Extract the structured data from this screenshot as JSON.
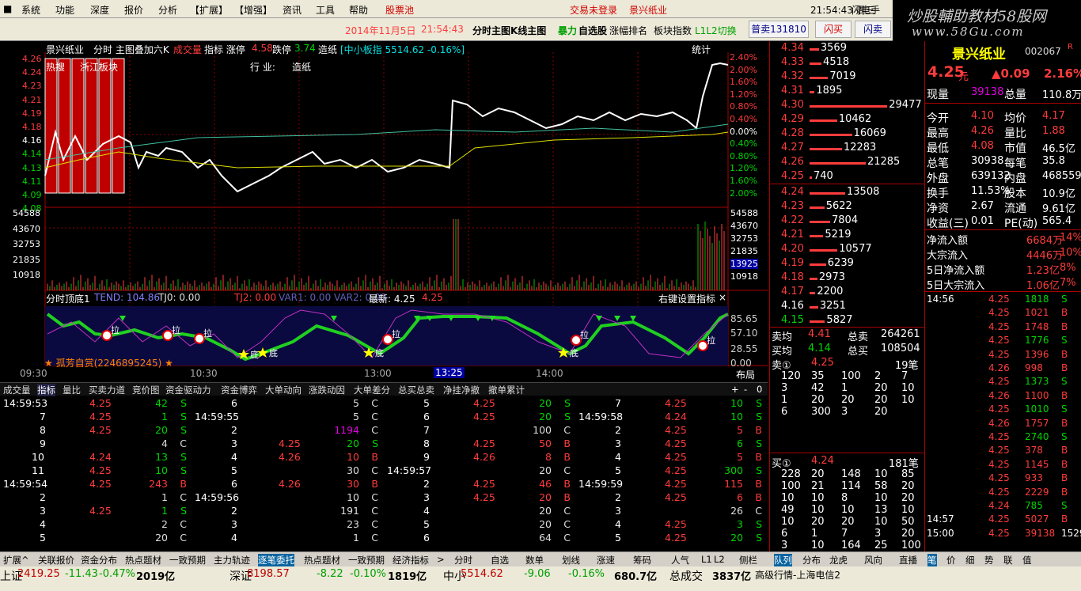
{
  "menu": {
    "items": [
      "系统",
      "功能",
      "深度",
      "报价",
      "分析",
      "【扩展】",
      "【增强】",
      "资讯",
      "工具",
      "帮助"
    ],
    "stock_pool": "股票池",
    "login_status": "交易未登录",
    "stock_title": "景兴纸业",
    "clock": "21:54:43 周三",
    "flash": "闪电手"
  },
  "header": {
    "date": "2014年11月5日",
    "time": "21:54:43",
    "chart_mode": "分时主图K线主图",
    "bull": "暴力",
    "watchlist": "自选股",
    "rank": "涨幅排名",
    "board": "板块指数",
    "level": "L1L2切换",
    "sell": "普卖131810",
    "flash_buy": "闪买",
    "flash_sell": "闪卖"
  },
  "brand": {
    "line1": "炒股輔助教材58股网",
    "line2": "www.58Gu.com"
  },
  "chart": {
    "title_name": "景兴纸业",
    "title_mode": "分时 主图叠加六K",
    "title_vol": "成交量",
    "title_rest": "指标 涨停",
    "limit_up": "4.58",
    "limit_down_label": "跌停",
    "limit_down": "3.74",
    "sector": "造纸",
    "index_label": "[中小板指 5514.62 -0.16%]",
    "stats": "统计",
    "hot_label": "热搜",
    "board_label": "浙江板块",
    "industry_label": "行  业:",
    "industry": "造纸",
    "prices": [
      "4.26",
      "4.24",
      "4.23",
      "4.21",
      "4.19",
      "4.18",
      "4.16",
      "4.14",
      "4.13",
      "4.11",
      "4.09",
      "4.08"
    ],
    "pcts": [
      "2.40%",
      "2.00%",
      "1.60%",
      "1.20%",
      "0.80%",
      "0.40%",
      "0.00%",
      "0.40%",
      "0.80%",
      "1.20%",
      "1.60%",
      "2.00%"
    ],
    "vols": [
      "54588",
      "43670",
      "32753",
      "21835",
      "10918"
    ],
    "vol_right": [
      "54588",
      "43670",
      "32753",
      "21835",
      "13925",
      "10918"
    ],
    "ind_title": "分时顶底1",
    "ind_tend": "TEND: 104.86",
    "ind_tj0": "TJ0: 0.00",
    "ind_tj2": "TJ2: 0.00",
    "ind_rest": "VAR1: 0.00  VAR2: 0.00",
    "ind_latest": "最新: 4.25",
    "ind_price": "4.25",
    "ind_setting": "右键设置指标",
    "ind_scale": [
      "85.65",
      "57.10",
      "28.55",
      "0.00"
    ],
    "promo": "孤芳自赏(2246895245)",
    "signal_la": "拉",
    "signal_di": "底",
    "times": [
      "09:30",
      "10:30",
      "13:00",
      "13:25",
      "14:00"
    ],
    "layout": "布局"
  },
  "tabs": [
    "成交量",
    "指标",
    "量比",
    "买卖力道",
    "竞价图",
    "资金驱动力",
    "资金博弈",
    "大单动向",
    "涨跌动因",
    "大单差分",
    "总买总卖",
    "净挂净撤",
    "撤单累计"
  ],
  "ticks": [
    [
      [
        "14:59:53",
        "4.25",
        "42",
        "S"
      ],
      [
        "7",
        "4.25",
        "1",
        "S"
      ],
      [
        "8",
        "4.25",
        "20",
        "S"
      ],
      [
        "9",
        "",
        "4",
        "C"
      ],
      [
        "10",
        "4.24",
        "13",
        "S"
      ],
      [
        "11",
        "4.25",
        "10",
        "S"
      ],
      [
        "14:59:54",
        "4.25",
        "243",
        "B"
      ],
      [
        "2",
        "",
        "1",
        "C"
      ],
      [
        "3",
        "4.25",
        "1",
        "S"
      ],
      [
        "4",
        "",
        "2",
        "C"
      ],
      [
        "5",
        "",
        "20",
        "C"
      ]
    ],
    [
      [
        "6",
        "",
        "5",
        "C"
      ],
      [
        "14:59:55",
        "",
        "5",
        "C"
      ],
      [
        "2",
        "",
        "1194",
        "C"
      ],
      [
        "3",
        "4.25",
        "20",
        "S"
      ],
      [
        "4",
        "4.26",
        "10",
        "B"
      ],
      [
        "5",
        "",
        "30",
        "C"
      ],
      [
        "6",
        "4.26",
        "30",
        "B"
      ],
      [
        "14:59:56",
        "",
        "10",
        "C"
      ],
      [
        "2",
        "",
        "191",
        "C"
      ],
      [
        "3",
        "",
        "23",
        "C"
      ],
      [
        "4",
        "",
        "1",
        "C"
      ]
    ],
    [
      [
        "5",
        "4.25",
        "20",
        "S"
      ],
      [
        "6",
        "4.25",
        "20",
        "S"
      ],
      [
        "7",
        "",
        "100",
        "C"
      ],
      [
        "8",
        "4.25",
        "50",
        "B"
      ],
      [
        "9",
        "4.26",
        "8",
        "B"
      ],
      [
        "14:59:57",
        "",
        "20",
        "C"
      ],
      [
        "2",
        "4.25",
        "46",
        "B"
      ],
      [
        "3",
        "4.25",
        "20",
        "B"
      ],
      [
        "4",
        "",
        "20",
        "C"
      ],
      [
        "5",
        "",
        "20",
        "C"
      ],
      [
        "6",
        "",
        "64",
        "C"
      ]
    ],
    [
      [
        "7",
        "4.25",
        "10",
        "S"
      ],
      [
        "14:59:58",
        "4.24",
        "10",
        "S"
      ],
      [
        "2",
        "4.25",
        "5",
        "B"
      ],
      [
        "3",
        "4.25",
        "6",
        "S"
      ],
      [
        "4",
        "4.25",
        "5",
        "B"
      ],
      [
        "5",
        "4.25",
        "300",
        "S"
      ],
      [
        "14:59:59",
        "4.25",
        "115",
        "B"
      ],
      [
        "2",
        "4.25",
        "6",
        "B"
      ],
      [
        "3",
        "",
        "26",
        "C"
      ],
      [
        "4",
        "4.25",
        "3",
        "S"
      ],
      [
        "5",
        "4.25",
        "20",
        "S"
      ]
    ]
  ],
  "orderbook": {
    "asks": [
      [
        "4.34",
        "3569"
      ],
      [
        "4.33",
        "4518"
      ],
      [
        "4.32",
        "7019"
      ],
      [
        "4.31",
        "1895"
      ],
      [
        "4.30",
        "29477"
      ],
      [
        "4.29",
        "10462"
      ],
      [
        "4.28",
        "16069"
      ],
      [
        "4.27",
        "12283"
      ],
      [
        "4.26",
        "21285"
      ],
      [
        "4.25",
        "740"
      ]
    ],
    "bids": [
      [
        "4.24",
        "13508"
      ],
      [
        "4.23",
        "5622"
      ],
      [
        "4.22",
        "7804"
      ],
      [
        "4.21",
        "5219"
      ],
      [
        "4.20",
        "10577"
      ],
      [
        "4.19",
        "6239"
      ],
      [
        "4.18",
        "2973"
      ],
      [
        "4.17",
        "2200"
      ],
      [
        "4.16",
        "3251"
      ],
      [
        "4.15",
        "5827"
      ]
    ],
    "avg_sell_label": "卖均",
    "avg_sell": "4.41",
    "total_sell_label": "总卖",
    "total_sell": "264261",
    "avg_buy_label": "买均",
    "avg_buy": "4.14",
    "total_buy_label": "总买",
    "total_buy": "108504",
    "sell1_label": "卖①",
    "sell1_price": "4.25",
    "sell1_count": "19笔",
    "sell_queue": [
      [
        "120",
        "35",
        "100",
        "2",
        "7"
      ],
      [
        "3",
        "42",
        "1",
        "20",
        "10"
      ],
      [
        "1",
        "20",
        "20",
        "20",
        "10"
      ],
      [
        "6",
        "300",
        "3",
        "20",
        ""
      ]
    ],
    "buy1_label": "买①",
    "buy1_price": "4.24",
    "buy1_count": "181笔",
    "buy_queue": [
      [
        "228",
        "20",
        "148",
        "10",
        "85"
      ],
      [
        "100",
        "21",
        "114",
        "58",
        "20"
      ],
      [
        "10",
        "10",
        "8",
        "10",
        "20"
      ],
      [
        "49",
        "10",
        "10",
        "13",
        "10"
      ],
      [
        "10",
        "20",
        "20",
        "10",
        "50"
      ],
      [
        "6",
        "1",
        "7",
        "3",
        "20"
      ],
      [
        "3",
        "10",
        "164",
        "25",
        "100"
      ]
    ]
  },
  "quote": {
    "name": "景兴纸业",
    "code": "002067",
    "flag": "R",
    "price": "4.25",
    "unit": "元",
    "change": "▲0.09",
    "pct": "2.16%",
    "rows": [
      [
        "现量",
        "39138",
        "总量",
        "110.8万"
      ],
      [
        "今开",
        "4.10",
        "均价",
        "4.17"
      ],
      [
        "最高",
        "4.26",
        "量比",
        "1.88"
      ],
      [
        "最低",
        "4.08",
        "市值",
        "46.5亿"
      ],
      [
        "总笔",
        "30938",
        "每笔",
        "35.8"
      ],
      [
        "外盘",
        "639132",
        "内盘",
        "468559"
      ],
      [
        "换手",
        "11.53%",
        "股本",
        "10.9亿"
      ],
      [
        "净资",
        "2.67",
        "流通",
        "9.61亿"
      ],
      [
        "收益(三)",
        "0.01",
        "PE(动)",
        "565.4"
      ]
    ],
    "flows": [
      [
        "净流入额",
        "6684万",
        "14%"
      ],
      [
        "大宗流入",
        "4446万",
        "10%"
      ],
      [
        "5日净流入额",
        "1.23亿",
        "8%"
      ],
      [
        "5日大宗流入",
        "1.06亿",
        "7%"
      ]
    ],
    "trades": [
      [
        "14:56",
        "4.25",
        "1818",
        "S"
      ],
      [
        "",
        "4.25",
        "1021",
        "B"
      ],
      [
        "",
        "4.25",
        "1748",
        "B"
      ],
      [
        "",
        "4.25",
        "1776",
        "S"
      ],
      [
        "",
        "4.25",
        "1396",
        "B"
      ],
      [
        "",
        "4.26",
        "998",
        "B"
      ],
      [
        "",
        "4.25",
        "1373",
        "S"
      ],
      [
        "",
        "4.26",
        "1100",
        "B"
      ],
      [
        "",
        "4.25",
        "1010",
        "S"
      ],
      [
        "",
        "4.26",
        "1757",
        "B"
      ],
      [
        "",
        "4.25",
        "2740",
        "S"
      ],
      [
        "",
        "4.25",
        "378",
        "B"
      ],
      [
        "",
        "4.25",
        "1145",
        "B"
      ],
      [
        "",
        "4.25",
        "933",
        "B"
      ],
      [
        "",
        "4.25",
        "2229",
        "B"
      ],
      [
        "",
        "4.24",
        "785",
        "S"
      ],
      [
        "14:57",
        "4.25",
        "5027",
        "B"
      ],
      [
        "15:00",
        "4.25",
        "39138",
        "1529"
      ]
    ]
  },
  "bottom_tabs": [
    "扩展^",
    "关联报价",
    "资金分布",
    "热点题材",
    "一致预期",
    "主力轨迹",
    "逐笔委托",
    "热点题材",
    "一致预期",
    "经济指标",
    ">",
    "分时",
    "自选",
    "数单",
    "划线",
    "涨速",
    "筹码",
    "人气",
    "L1",
    "L2",
    "侧栏",
    "队列",
    "分布",
    "龙虎",
    "风向",
    "直播",
    "笔",
    "价",
    "细",
    "势",
    "联",
    "值"
  ],
  "status": [
    [
      "上证",
      "2419.25",
      "-11.43",
      "-0.47%",
      "2019亿"
    ],
    [
      "深证",
      "8198.57",
      "-8.22",
      "-0.10%",
      "1819亿"
    ],
    [
      "中小",
      "5514.62",
      "-9.06",
      "-0.16%",
      "680.7亿"
    ]
  ],
  "status_total_label": "总成交",
  "status_total": "3837亿",
  "status_feed": "高级行情-上海电信2"
}
